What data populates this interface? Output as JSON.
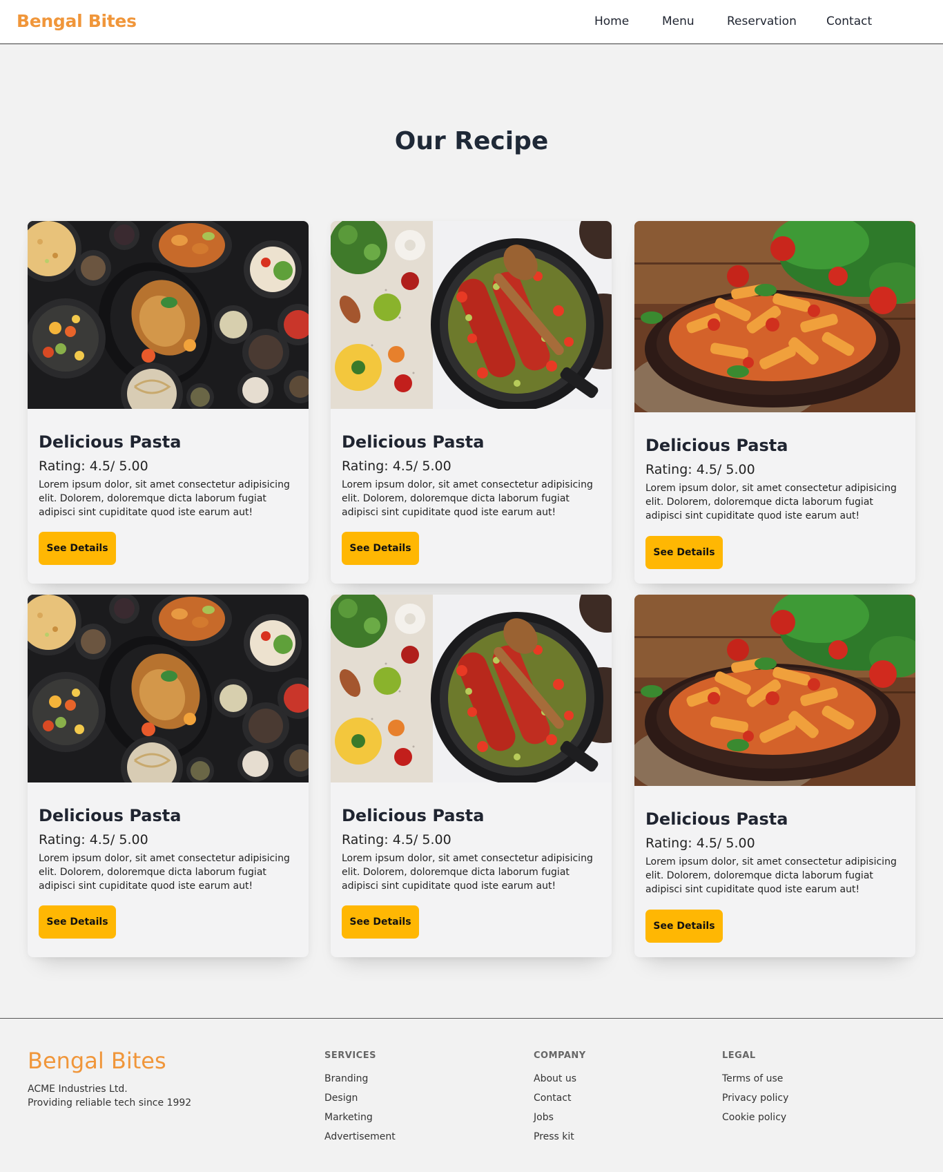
{
  "nav": {
    "brand": "Bengal Bites",
    "links": [
      "Home",
      "Menu",
      "Reservation",
      "Contact"
    ]
  },
  "section": {
    "title": "Our Recipe"
  },
  "cards": [
    {
      "title": "Delicious Pasta",
      "rating": "Rating: 4.5/ 5.00",
      "description": "Lorem ipsum dolor, sit amet consectetur adipisicing elit. Dolorem, doloremque dicta laborum fugiat adipisci sint cupiditate quod iste earum aut!",
      "button": "See Details",
      "image": "feast-platter"
    },
    {
      "title": "Delicious Pasta",
      "rating": "Rating: 4.5/ 5.00",
      "description": "Lorem ipsum dolor, sit amet consectetur adipisicing elit. Dolorem, doloremque dicta laborum fugiat adipisci sint cupiditate quod iste earum aut!",
      "button": "See Details",
      "image": "pan-sausage"
    },
    {
      "title": "Delicious Pasta",
      "rating": "Rating: 4.5/ 5.00",
      "description": "Lorem ipsum dolor, sit amet consectetur adipisicing elit. Dolorem, doloremque dicta laborum fugiat adipisci sint cupiditate quod iste earum aut!",
      "button": "See Details",
      "image": "penne-plate"
    },
    {
      "title": "Delicious Pasta",
      "rating": "Rating: 4.5/ 5.00",
      "description": "Lorem ipsum dolor, sit amet consectetur adipisicing elit. Dolorem, doloremque dicta laborum fugiat adipisci sint cupiditate quod iste earum aut!",
      "button": "See Details",
      "image": "feast-platter"
    },
    {
      "title": "Delicious Pasta",
      "rating": "Rating: 4.5/ 5.00",
      "description": "Lorem ipsum dolor, sit amet consectetur adipisicing elit. Dolorem, doloremque dicta laborum fugiat adipisci sint cupiditate quod iste earum aut!",
      "button": "See Details",
      "image": "pan-sausage"
    },
    {
      "title": "Delicious Pasta",
      "rating": "Rating: 4.5/ 5.00",
      "description": "Lorem ipsum dolor, sit amet consectetur adipisicing elit. Dolorem, doloremque dicta laborum fugiat adipisci sint cupiditate quod iste earum aut!",
      "button": "See Details",
      "image": "penne-plate"
    }
  ],
  "footer": {
    "brand": "Bengal Bites",
    "company": "ACME Industries Ltd.",
    "tagline": "Providing reliable tech since 1992",
    "columns": [
      {
        "title": "SERVICES",
        "links": [
          "Branding",
          "Design",
          "Marketing",
          "Advertisement"
        ]
      },
      {
        "title": "COMPANY",
        "links": [
          "About us",
          "Contact",
          "Jobs",
          "Press kit"
        ]
      },
      {
        "title": "LEGAL",
        "links": [
          "Terms of use",
          "Privacy policy",
          "Cookie policy"
        ]
      }
    ]
  },
  "colors": {
    "brand": "#f0963a",
    "button": "#ffb703",
    "background": "#f2f2f2",
    "text": "#1f2430"
  }
}
